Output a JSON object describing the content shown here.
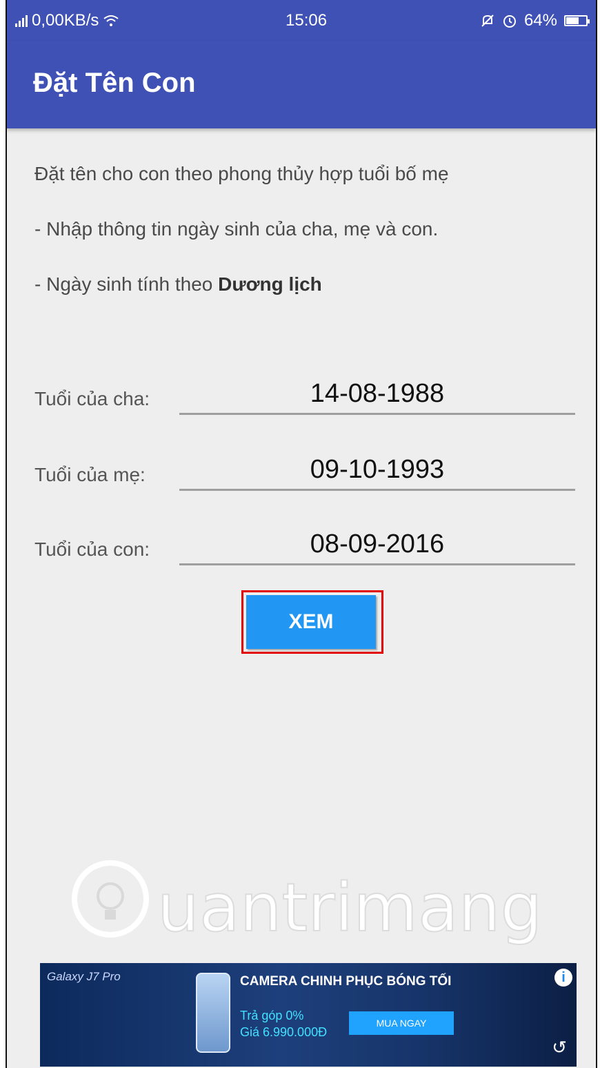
{
  "status_bar": {
    "network_speed": "0,00KB/s",
    "time": "15:06",
    "battery": "64%",
    "battery_level": 0.64
  },
  "app_bar": {
    "title": "Đặt Tên Con"
  },
  "intro": {
    "line1": "Đặt tên cho con theo phong thủy hợp tuổi bố mẹ",
    "line2": "- Nhập thông tin ngày sinh của cha, mẹ và con.",
    "line3_prefix": "- Ngày sinh tính theo ",
    "line3_bold": "Dương lịch"
  },
  "form": {
    "father_label": "Tuổi của cha:",
    "father_value": "14-08-1988",
    "mother_label": "Tuổi của mẹ:",
    "mother_value": "09-10-1993",
    "child_label": "Tuổi của con:",
    "child_value": "08-09-2016",
    "submit_label": "XEM"
  },
  "watermark": {
    "text": "uantrimang"
  },
  "ad": {
    "brand": "Galaxy J7 Pro",
    "headline": "CAMERA CHINH PHỤC BÓNG TỐI",
    "line1": "Trả góp 0%",
    "line2": "Giá 6.990.000Đ",
    "cta": "MUA NGAY",
    "info": "i"
  }
}
